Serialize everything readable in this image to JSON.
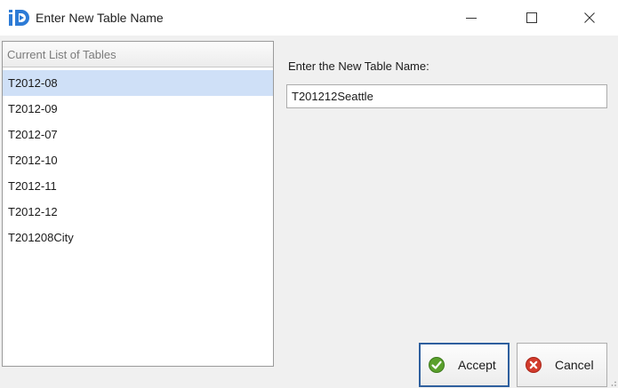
{
  "window": {
    "title": "Enter New Table Name",
    "icons": {
      "app": "app-logo-icon",
      "minimize": "minimize-icon",
      "maximize": "maximize-icon",
      "close": "close-icon"
    }
  },
  "tables_panel": {
    "header": "Current List of Tables",
    "items": [
      "T2012-08",
      "T2012-09",
      "T2012-07",
      "T2012-10",
      "T2012-11",
      "T2012-12",
      "T201208City"
    ],
    "selected_index": 0
  },
  "form": {
    "label": "Enter the New Table Name:",
    "input_value": "T201212Seattle"
  },
  "buttons": {
    "accept": {
      "label": "Accept",
      "icon": "check-icon"
    },
    "cancel": {
      "label": "Cancel",
      "icon": "cancel-icon"
    }
  },
  "colors": {
    "selection": "#cfe0f7",
    "focus_border": "#2e5f9e",
    "accept_icon": "#5aa02c",
    "cancel_icon": "#d23b2c",
    "logo": "#2d7bd6"
  }
}
